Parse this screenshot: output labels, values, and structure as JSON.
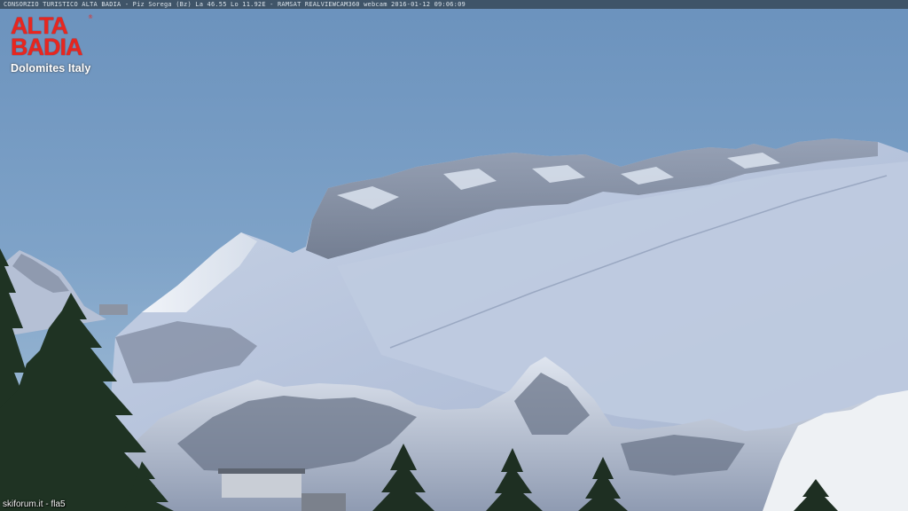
{
  "overlay": {
    "caption": "CONSORZIO TURISTICO ALTA BADIA - Piz Sorega (Bz)  La 46.55 Lo 11.92E - RAMSAT REALVIEWCAM360 webcam 2016-01-12 09:06:09"
  },
  "logo": {
    "line1": "ALTA",
    "line2": "BADIA",
    "registered": "®",
    "subtitle": "Dolomites Italy"
  },
  "footer": {
    "credit": "skiforum.it - fla5"
  },
  "colors": {
    "sky_top": "#6d93bd",
    "sky_bottom": "#a9c3da",
    "snow": "#e8eef6",
    "snow_shadow": "#a9b8d3",
    "rock": "#6f7a8e",
    "logo_red": "#e8261f",
    "trees": "#1f3323"
  }
}
